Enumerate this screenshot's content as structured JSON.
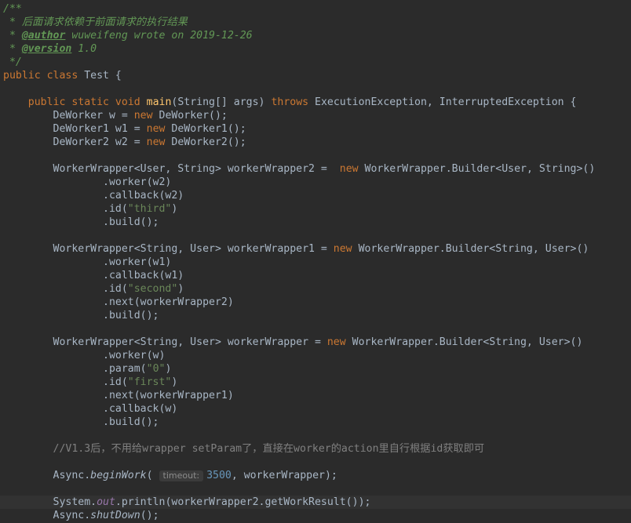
{
  "code": {
    "doc_open": "/**",
    "doc_line1": " * 后面请求依赖于前面请求的执行结果",
    "doc_author_prefix": " * ",
    "doc_author_tag": "@author",
    "doc_author_text": " wuweifeng wrote on 2019-12-26",
    "doc_version_prefix": " * ",
    "doc_version_tag": "@version",
    "doc_version_text": " 1.0",
    "doc_close": " */",
    "class_kw": "public class",
    "class_name": " Test {",
    "main_mods": "    public static void ",
    "main_name": "main",
    "main_params": "(String[] args) ",
    "main_throws": "throws",
    "main_exceptions": " ExecutionException, InterruptedException {",
    "w_decl": "        DeWorker w = ",
    "w_new": "new",
    "w_ctor": " DeWorker();",
    "w1_decl": "        DeWorker1 w1 = ",
    "w1_new": "new",
    "w1_ctor": " DeWorker1();",
    "w2_decl": "        DeWorker2 w2 = ",
    "w2_new": "new",
    "w2_ctor": " DeWorker2();",
    "ww2_decl": "        WorkerWrapper<User, String> workerWrapper2 =  ",
    "ww2_new": "new",
    "ww2_builder": " WorkerWrapper.Builder<User, String>()",
    "ww2_worker": "                .worker(w2)",
    "ww2_callback": "                .callback(w2)",
    "ww2_id_pre": "                .id(",
    "ww2_id_str": "\"third\"",
    "ww2_id_post": ")",
    "ww2_build": "                .build();",
    "ww1_decl": "        WorkerWrapper<String, User> workerWrapper1 = ",
    "ww1_new": "new",
    "ww1_builder": " WorkerWrapper.Builder<String, User>()",
    "ww1_worker": "                .worker(w1)",
    "ww1_callback": "                .callback(w1)",
    "ww1_id_pre": "                .id(",
    "ww1_id_str": "\"second\"",
    "ww1_id_post": ")",
    "ww1_next": "                .next(workerWrapper2)",
    "ww1_build": "                .build();",
    "ww_decl": "        WorkerWrapper<String, User> workerWrapper = ",
    "ww_new": "new",
    "ww_builder": " WorkerWrapper.Builder<String, User>()",
    "ww_worker": "                .worker(w)",
    "ww_param_pre": "                .param(",
    "ww_param_str": "\"0\"",
    "ww_param_post": ")",
    "ww_id_pre": "                .id(",
    "ww_id_str": "\"first\"",
    "ww_id_post": ")",
    "ww_next": "                .next(workerWrapper1)",
    "ww_callback": "                .callback(w)",
    "ww_build": "                .build();",
    "comment": "        //V1.3后，不用给wrapper setParam了，直接在worker的action里自行根据id获取即可",
    "async_begin_pre": "        Async.",
    "async_begin_method": "beginWork",
    "async_begin_paren": "( ",
    "async_hint": "timeout:",
    "async_num": "3500",
    "async_begin_post": ", workerWrapper);",
    "sysout_pre": "        System.",
    "sysout_field": "out",
    "sysout_post": ".println(workerWrapper2.getWorkResult());",
    "shutdown_pre": "        Async.",
    "shutdown_method": "shutDown",
    "shutdown_post": "();"
  },
  "colors": {
    "background": "#2b2b2b",
    "text": "#a9b7c6",
    "keyword": "#cc7832",
    "method_decl": "#ffc66d",
    "string": "#6a8759",
    "number": "#6897bb",
    "comment": "#808080",
    "javadoc": "#629755",
    "static_field": "#9876aa"
  }
}
